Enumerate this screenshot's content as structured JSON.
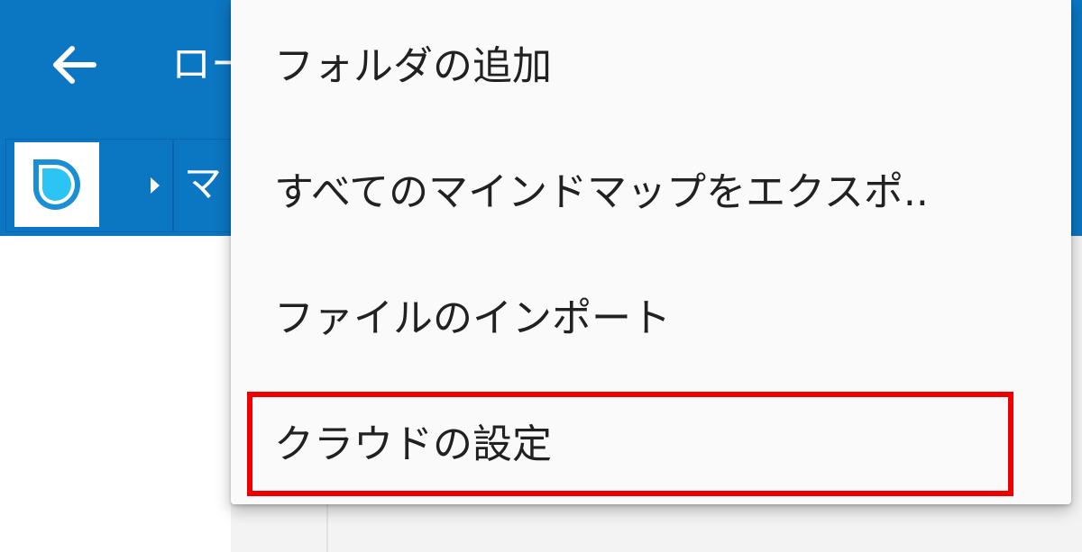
{
  "colors": {
    "appbar": "#0b76c1",
    "menu_background": "#fafafa",
    "highlight": "#ee0000"
  },
  "appbar": {
    "back_icon": "arrow-left-icon",
    "title": "ロー"
  },
  "breadcrumb": {
    "root_icon": "app-logo-icon",
    "separator_icon": "triangle-right-icon",
    "item_label": "マ"
  },
  "menu": {
    "items": [
      {
        "label": "フォルダの追加"
      },
      {
        "label": "すべてのマインドマップをエクスポ.."
      },
      {
        "label": "ファイルのインポート"
      },
      {
        "label": "クラウドの設定",
        "highlighted": true
      }
    ]
  }
}
